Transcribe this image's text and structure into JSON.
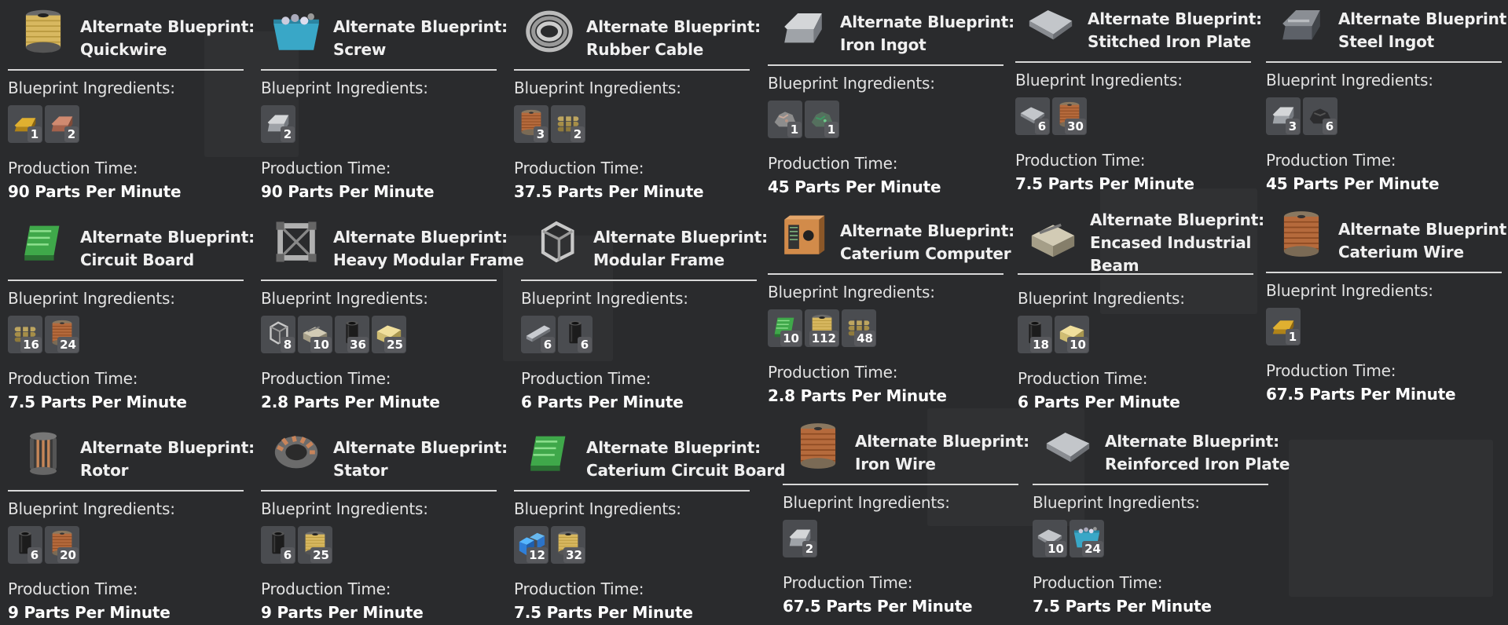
{
  "labels": {
    "ingredients": "Blueprint Ingredients:",
    "production_time": "Production Time:"
  },
  "cards": [
    {
      "title_prefix": "Alternate Blueprint:",
      "title_name": "Quickwire",
      "icon": "quickwire-spool-icon",
      "ingredients": [
        {
          "icon": "caterium-ingot-icon",
          "count": "1"
        },
        {
          "icon": "copper-ingot-icon",
          "count": "2"
        }
      ],
      "rate": "90 Parts Per Minute"
    },
    {
      "title_prefix": "Alternate Blueprint:",
      "title_name": "Screw",
      "icon": "screw-bin-icon",
      "ingredients": [
        {
          "icon": "iron-ingot-icon",
          "count": "2"
        }
      ],
      "rate": "90 Parts Per Minute"
    },
    {
      "title_prefix": "Alternate Blueprint:",
      "title_name": "Rubber Cable",
      "icon": "rubber-cable-icon",
      "ingredients": [
        {
          "icon": "wire-spool-icon",
          "count": "3"
        },
        {
          "icon": "quickwire-bundle-icon",
          "count": "2"
        }
      ],
      "rate": "37.5 Parts Per Minute"
    },
    {
      "title_prefix": "Alternate Blueprint:",
      "title_name": "Iron Ingot",
      "icon": "iron-ingot-icon",
      "ingredients": [
        {
          "icon": "iron-ore-icon",
          "count": "1"
        },
        {
          "icon": "copper-ore-icon",
          "count": "1"
        }
      ],
      "rate": "45 Parts Per Minute"
    },
    {
      "title_prefix": "Alternate Blueprint:",
      "title_name": "Stitched Iron Plate",
      "icon": "iron-plate-icon",
      "ingredients": [
        {
          "icon": "iron-plate-icon",
          "count": "6"
        },
        {
          "icon": "wire-spool-icon",
          "count": "30"
        }
      ],
      "rate": "7.5 Parts Per Minute"
    },
    {
      "title_prefix": "Alternate Blueprint:",
      "title_name": "Steel Ingot",
      "icon": "steel-ingot-icon",
      "ingredients": [
        {
          "icon": "iron-ingot-icon",
          "count": "3"
        },
        {
          "icon": "coal-icon",
          "count": "6"
        }
      ],
      "rate": "45 Parts Per Minute"
    },
    {
      "title_prefix": "Alternate Blueprint:",
      "title_name": "Circuit Board",
      "icon": "circuit-board-icon",
      "ingredients": [
        {
          "icon": "quickwire-bundle-icon",
          "count": "16"
        },
        {
          "icon": "wire-spool-icon",
          "count": "24"
        }
      ],
      "rate": "7.5 Parts Per Minute"
    },
    {
      "title_prefix": "Alternate Blueprint:",
      "title_name": "Heavy Modular Frame",
      "icon": "heavy-modular-frame-icon",
      "ingredients": [
        {
          "icon": "modular-frame-icon",
          "count": "8"
        },
        {
          "icon": "encased-beam-icon",
          "count": "10"
        },
        {
          "icon": "steel-pipe-icon",
          "count": "36"
        },
        {
          "icon": "concrete-icon",
          "count": "25"
        }
      ],
      "rate": "2.8 Parts Per Minute"
    },
    {
      "title_prefix": "Alternate Blueprint:",
      "title_name": "Modular Frame",
      "icon": "modular-frame-icon",
      "ingredients": [
        {
          "icon": "iron-rod-icon",
          "count": "6"
        },
        {
          "icon": "steel-pipe-icon",
          "count": "6"
        }
      ],
      "rate": "6 Parts Per Minute"
    },
    {
      "title_prefix": "Alternate Blueprint:",
      "title_name": "Caterium Computer",
      "icon": "computer-icon",
      "ingredients": [
        {
          "icon": "circuit-board-icon",
          "count": "10"
        },
        {
          "icon": "quickwire-spool-icon",
          "count": "112"
        },
        {
          "icon": "quickwire-bundle-icon",
          "count": "48"
        }
      ],
      "rate": "2.8 Parts Per Minute"
    },
    {
      "title_prefix": "Alternate Blueprint:",
      "title_name": "Encased Industrial Beam",
      "icon": "encased-beam-icon",
      "ingredients": [
        {
          "icon": "steel-pipe-icon",
          "count": "18"
        },
        {
          "icon": "concrete-icon",
          "count": "10"
        }
      ],
      "rate": "6 Parts Per Minute"
    },
    {
      "title_prefix": "Alternate Blueprint:",
      "title_name": "Caterium Wire",
      "icon": "wire-spool-icon",
      "ingredients": [
        {
          "icon": "caterium-ingot-icon",
          "count": "1"
        }
      ],
      "rate": "67.5 Parts Per Minute"
    },
    {
      "title_prefix": "Alternate Blueprint:",
      "title_name": "Rotor",
      "icon": "rotor-icon",
      "ingredients": [
        {
          "icon": "steel-pipe-icon",
          "count": "6"
        },
        {
          "icon": "wire-spool-icon",
          "count": "20"
        }
      ],
      "rate": "9 Parts Per Minute"
    },
    {
      "title_prefix": "Alternate Blueprint:",
      "title_name": "Stator",
      "icon": "stator-icon",
      "ingredients": [
        {
          "icon": "steel-pipe-icon",
          "count": "6"
        },
        {
          "icon": "quickwire-spool-icon",
          "count": "25"
        }
      ],
      "rate": "9 Parts Per Minute"
    },
    {
      "title_prefix": "Alternate Blueprint:",
      "title_name": "Caterium Circuit Board",
      "icon": "circuit-board-icon",
      "ingredients": [
        {
          "icon": "plastic-icon",
          "count": "12"
        },
        {
          "icon": "quickwire-spool-icon",
          "count": "32"
        }
      ],
      "rate": "7.5 Parts Per Minute"
    },
    {
      "title_prefix": "Alternate Blueprint:",
      "title_name": "Iron Wire",
      "icon": "wire-spool-icon",
      "ingredients": [
        {
          "icon": "iron-ingot-icon",
          "count": "2"
        }
      ],
      "rate": "67.5 Parts Per Minute"
    },
    {
      "title_prefix": "Alternate Blueprint:",
      "title_name": "Reinforced Iron Plate",
      "icon": "iron-plate-icon",
      "ingredients": [
        {
          "icon": "iron-plate-icon",
          "count": "10"
        },
        {
          "icon": "screw-bin-icon",
          "count": "24"
        }
      ],
      "rate": "7.5 Parts Per Minute"
    }
  ]
}
